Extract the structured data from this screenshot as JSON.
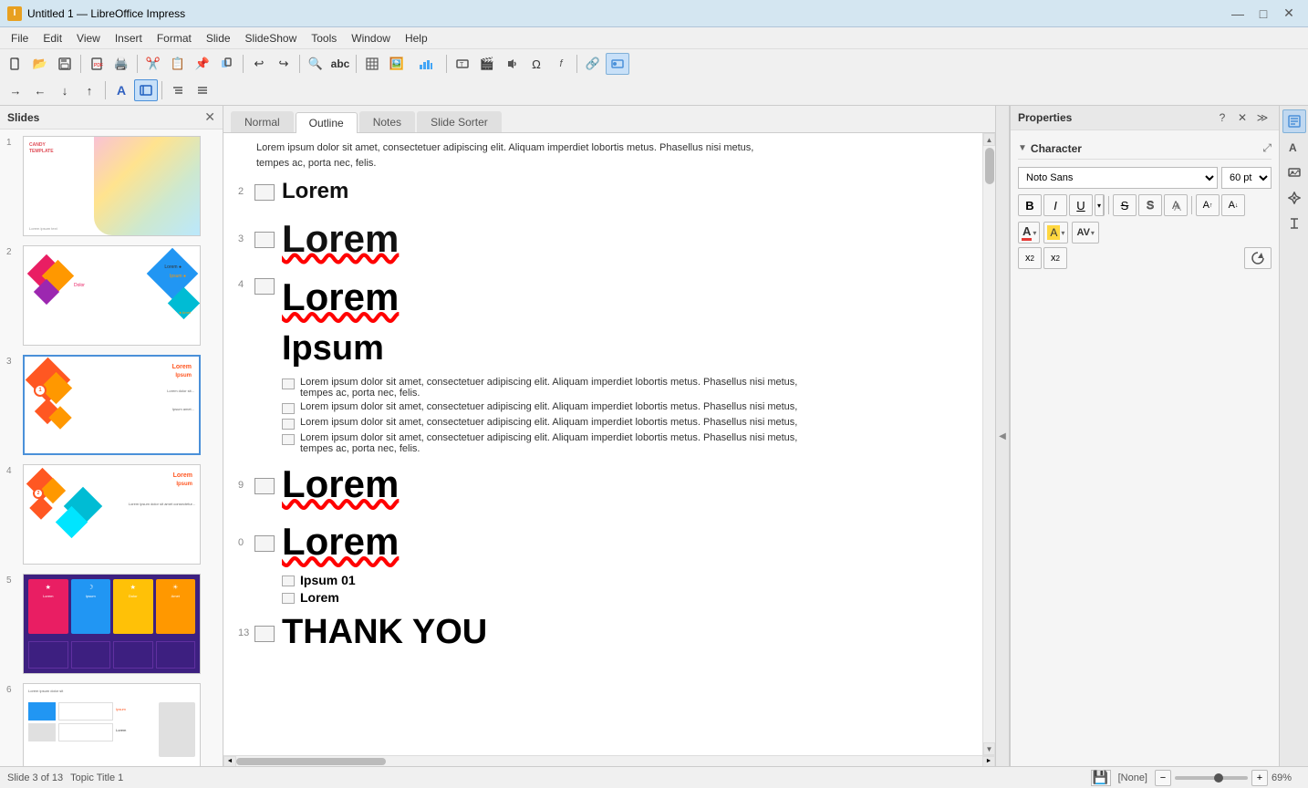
{
  "titlebar": {
    "title": "Untitled 1 — LibreOffice Impress",
    "icon": "I",
    "btn_minimize": "—",
    "btn_maximize": "□",
    "btn_close": "✕"
  },
  "menubar": {
    "items": [
      "File",
      "Edit",
      "View",
      "Insert",
      "Format",
      "Slide",
      "SlideShow",
      "Tools",
      "Window",
      "Help"
    ]
  },
  "toolbar1": {
    "buttons": [
      "new",
      "open",
      "save",
      "export",
      "print",
      "",
      "cut",
      "copy",
      "paste",
      "clone",
      "",
      "undo",
      "redo",
      "",
      "zoom",
      "spellcheck"
    ]
  },
  "toolbar2": {
    "buttons": [
      "insert-table",
      "insert-img",
      "insert-chart",
      "insert-box",
      "insert-movie",
      "insert-audio",
      "insert-special",
      "insert-link",
      "forms"
    ]
  },
  "view_tabs": {
    "tabs": [
      "Normal",
      "Outline",
      "Notes",
      "Slide Sorter"
    ],
    "active": "Outline"
  },
  "slides_panel": {
    "title": "Slides",
    "slides": [
      {
        "number": "1"
      },
      {
        "number": "2"
      },
      {
        "number": "3"
      },
      {
        "number": "4"
      },
      {
        "number": "5"
      },
      {
        "number": "6"
      }
    ]
  },
  "outline": {
    "entries": [
      {
        "num": "",
        "level": "body",
        "text": "Lorem ipsum dolor sit amet, consectetuer adipiscing elit. Aliquam imperdiet lobortis metus. Phasellus nisi metus, tempes ac, porta nec, felis."
      },
      {
        "num": "2",
        "level": "heading",
        "text": "Lorem"
      },
      {
        "num": "3",
        "level": "title",
        "text": "Lorem"
      },
      {
        "num": "4",
        "level": "title",
        "text": "Lorem"
      },
      {
        "num": "",
        "level": "title2",
        "text": "Ipsum"
      },
      {
        "num": "",
        "level": "body",
        "text": "Lorem ipsum dolor sit amet, consectetuer adipiscing elit. Aliquam imperdiet lobortis metus. Phasellus nisi metus, tempes ac, porta nec, felis."
      },
      {
        "num": "",
        "level": "body",
        "text": "Lorem ipsum dolor sit amet, consectetuer adipiscing elit. Aliquam imperdiet lobortis metus. Phasellus nisi metus,"
      },
      {
        "num": "",
        "level": "body",
        "text": "Lorem ipsum dolor sit amet, consectetuer adipiscing elit. Aliquam imperdiet lobortis metus. Phasellus nisi metus,"
      },
      {
        "num": "",
        "level": "body",
        "text": "Lorem ipsum dolor sit amet, consectetuer adipiscing elit. Aliquam imperdiet lobortis metus. Phasellus nisi metus, tempes ac, porta nec, felis."
      },
      {
        "num": "9",
        "level": "title",
        "text": "Lorem"
      },
      {
        "num": "0",
        "level": "title",
        "text": "Lorem"
      },
      {
        "num": "",
        "level": "sub",
        "text": "Ipsum 01"
      },
      {
        "num": "",
        "level": "sub",
        "text": "Lorem"
      },
      {
        "num": "13",
        "level": "title",
        "text": "THANK YOU"
      }
    ]
  },
  "properties": {
    "title": "Properties",
    "question_btn": "?",
    "close_btn": "✕",
    "more_btn": "≫",
    "character_section": {
      "title": "Character",
      "font_name": "Noto Sans",
      "font_size": "60 pt",
      "format_buttons": [
        "B",
        "I",
        "U",
        "S̶",
        "S",
        "Aa",
        "A↑",
        "A↓"
      ],
      "font_color_label": "A",
      "highlight_color_label": "A",
      "spacing_label": "AV",
      "superscript": "x²",
      "subscript": "x₂",
      "reset_icon": "↺"
    }
  },
  "statusbar": {
    "slide_info": "Slide 3 of 13",
    "topic_title": "Topic Title 1",
    "save_icon": "💾",
    "style": "[None]",
    "zoom_level": "69%"
  }
}
